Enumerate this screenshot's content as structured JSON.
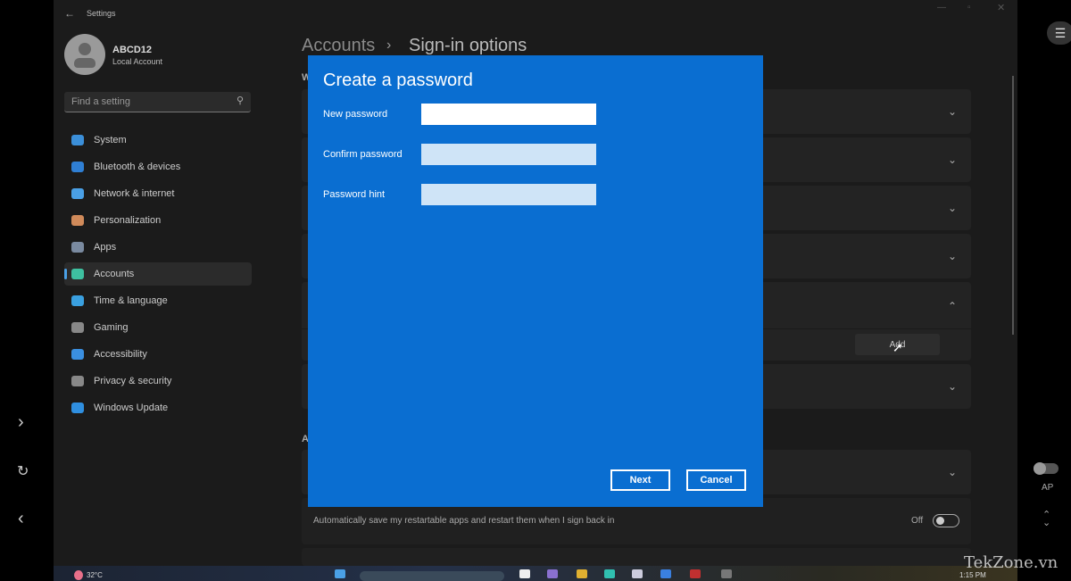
{
  "window": {
    "title": "Settings"
  },
  "user": {
    "name": "ABCD12",
    "type": "Local Account"
  },
  "search": {
    "placeholder": "Find a setting"
  },
  "sidebar": {
    "items": [
      {
        "label": "System",
        "color": "#3b8fd9"
      },
      {
        "label": "Bluetooth & devices",
        "color": "#2f7fd4"
      },
      {
        "label": "Network & internet",
        "color": "#4aa0e6"
      },
      {
        "label": "Personalization",
        "color": "#d08a5a"
      },
      {
        "label": "Apps",
        "color": "#7a8aa0"
      },
      {
        "label": "Accounts",
        "color": "#3ec0a0",
        "selected": true
      },
      {
        "label": "Time & language",
        "color": "#3aa0e0"
      },
      {
        "label": "Gaming",
        "color": "#888"
      },
      {
        "label": "Accessibility",
        "color": "#3a8fe0"
      },
      {
        "label": "Privacy & security",
        "color": "#888"
      },
      {
        "label": "Windows Update",
        "color": "#2f8fe0"
      }
    ]
  },
  "breadcrumb": {
    "parent": "Accounts",
    "separator": "›",
    "current": "Sign-in options"
  },
  "content": {
    "section1_partial": "W",
    "section2_partial": "A",
    "add_button": "Add",
    "restart_apps_label": "Automatically save my restartable apps and restart them when I sign back in",
    "restart_apps_state": "Off"
  },
  "dialog": {
    "title": "Create a password",
    "fields": [
      {
        "label": "New password",
        "value": ""
      },
      {
        "label": "Confirm password",
        "value": ""
      },
      {
        "label": "Password hint",
        "value": ""
      }
    ],
    "next": "Next",
    "cancel": "Cancel",
    "accent": "#0a6ed1"
  },
  "taskbar": {
    "weather": "32°C",
    "time": "1:15 PM"
  },
  "side_controls": {
    "toggle_label": "AP"
  },
  "watermark": "TekZone.vn"
}
